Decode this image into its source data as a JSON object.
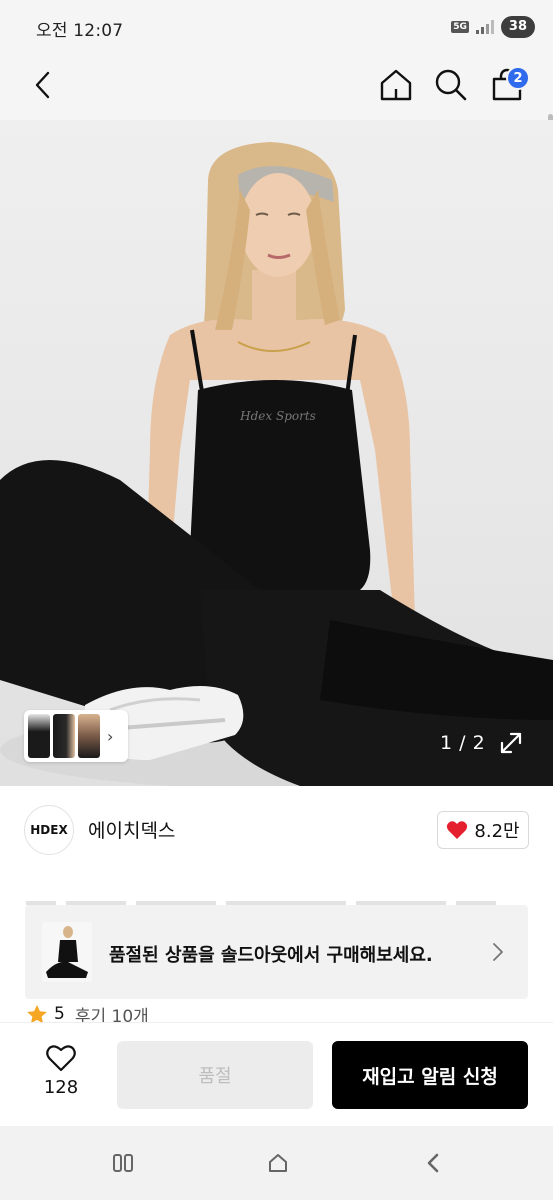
{
  "status_bar": {
    "time": "오전 12:07",
    "network": "5G",
    "battery": "38"
  },
  "nav": {
    "back_icon": "chevron-left-icon",
    "home_icon": "home-icon",
    "search_icon": "search-icon",
    "cart_icon": "shopping-bag-icon",
    "cart_count": "2"
  },
  "gallery": {
    "counter": "1 / 2",
    "expand_icon": "expand-icon",
    "thumbnail_arrow": "›"
  },
  "brand": {
    "logo_text": "HDEX",
    "name": "에이치덱스",
    "like_count": "8.2만"
  },
  "soldout_banner": {
    "text": "품절된 상품을 솔드아웃에서 구매해보세요."
  },
  "rating": {
    "score": "5",
    "review_label": "후기 10개"
  },
  "bottom_bar": {
    "wish_count": "128",
    "soldout_label": "품절",
    "restock_label": "재입고 알림 신청"
  },
  "colors": {
    "accent_blue": "#2f6bec",
    "heart_red": "#e5202e",
    "star_orange": "#f5a623",
    "primary_black": "#000000"
  }
}
